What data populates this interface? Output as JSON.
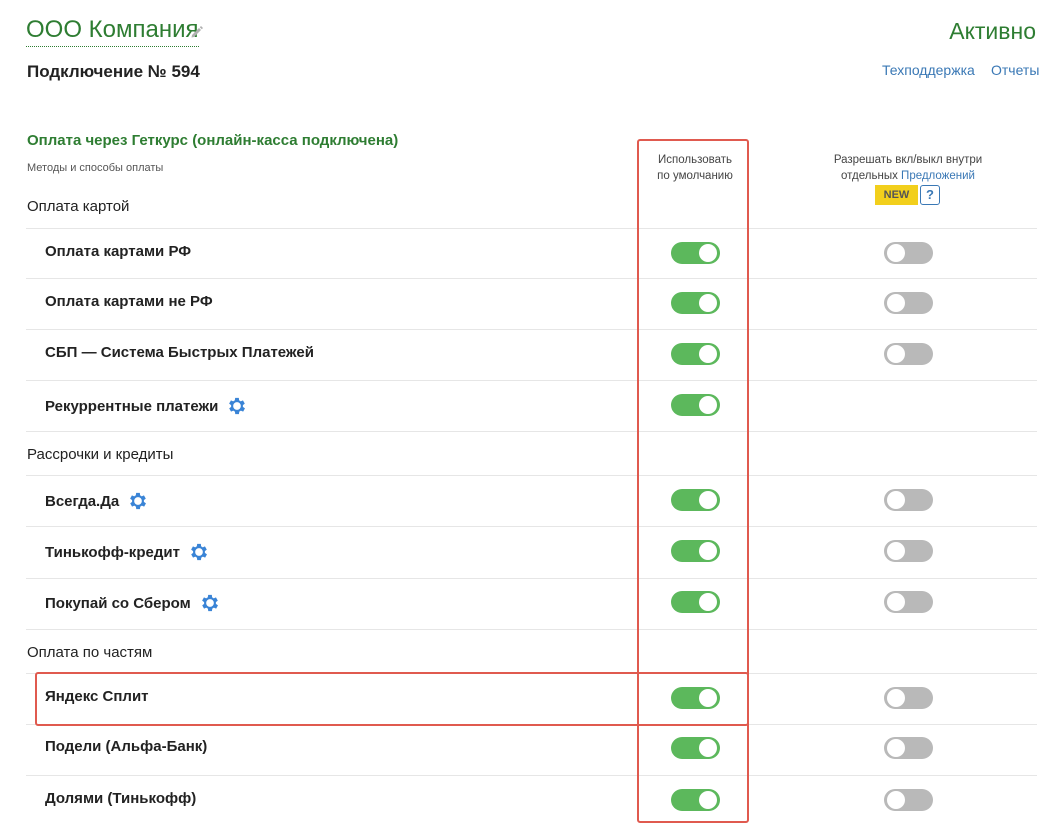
{
  "header": {
    "company": "ООО Компания",
    "status": "Активно",
    "connection": "Подключение № 594",
    "links": {
      "support": "Техподдержка",
      "reports": "Отчеты"
    }
  },
  "section": {
    "title": "Оплата через Геткурс (онлайн-касса подключена)",
    "subtitle": "Методы и способы оплаты"
  },
  "columns": {
    "default_line1": "Использовать",
    "default_line2": "по умолчанию",
    "allow_line1": "Разрешать вкл/выкл внутри",
    "allow_line2_prefix": "отдельных",
    "allow_link": "Предложений",
    "badge_new": "NEW",
    "badge_help": "?"
  },
  "groups": {
    "cards": "Оплата картой",
    "credit": "Рассрочки и кредиты",
    "parts": "Оплата по частям"
  },
  "rows": [
    {
      "label": "Оплата картами РФ",
      "default_on": true,
      "allow_on": false,
      "has_allow": true,
      "gear": false
    },
    {
      "label": "Оплата картами не РФ",
      "default_on": true,
      "allow_on": false,
      "has_allow": true,
      "gear": false
    },
    {
      "label": "СБП — Система Быстрых Платежей",
      "default_on": true,
      "allow_on": false,
      "has_allow": true,
      "gear": false
    },
    {
      "label": "Рекуррентные платежи",
      "default_on": true,
      "allow_on": false,
      "has_allow": false,
      "gear": true
    },
    {
      "label": "Всегда.Да",
      "default_on": true,
      "allow_on": false,
      "has_allow": true,
      "gear": true
    },
    {
      "label": "Тинькофф-кредит",
      "default_on": true,
      "allow_on": false,
      "has_allow": true,
      "gear": true
    },
    {
      "label": "Покупай со Сбером",
      "default_on": true,
      "allow_on": false,
      "has_allow": true,
      "gear": true
    },
    {
      "label": "Яндекс Сплит",
      "default_on": true,
      "allow_on": false,
      "has_allow": true,
      "gear": false
    },
    {
      "label": "Подели (Альфа-Банк)",
      "default_on": true,
      "allow_on": false,
      "has_allow": true,
      "gear": false
    },
    {
      "label": "Долями (Тинькофф)",
      "default_on": true,
      "allow_on": false,
      "has_allow": true,
      "gear": false
    }
  ],
  "colors": {
    "accent_green": "#2e7d32",
    "toggle_on": "#5cb85c",
    "toggle_off": "#b9b9b9",
    "link_blue": "#3a78b5",
    "highlight_red": "#e05a4f",
    "badge_yellow": "#f2cf1c"
  },
  "icons": {
    "edit": "pencil-icon",
    "settings": "gear-icon"
  }
}
